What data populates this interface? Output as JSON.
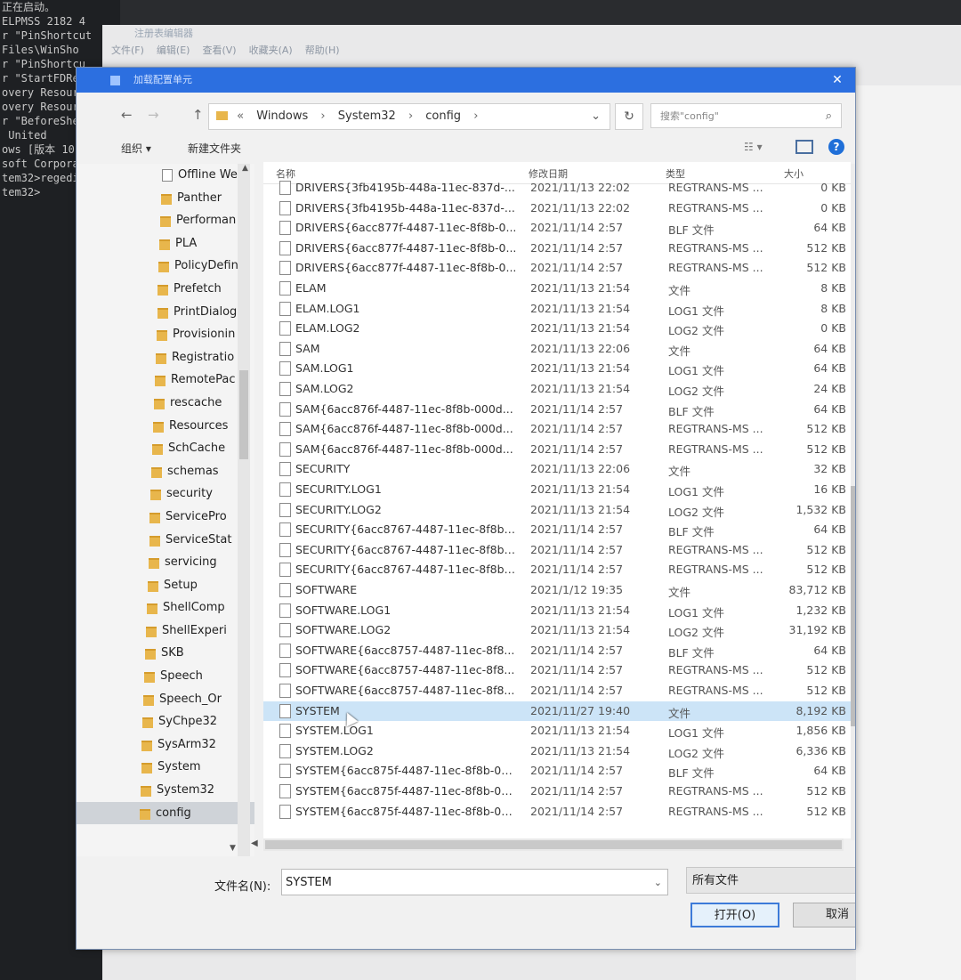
{
  "console": {
    "lines": [
      "正在启动。",
      "ELPMSS 2182 4",
      "r \"PinShortcut",
      "Files\\WinSho",
      "",
      "r \"PinShortcu",
      "r \"StartFDRes",
      "overy Resourc",
      "overy Resourc",
      "",
      "r \"BeforeShel",
      " United",
      "ows [版本 10",
      "soft Corpora",
      "",
      "tem32>regedi",
      "",
      "tem32>"
    ]
  },
  "bg_window": {
    "title": "注册表编辑器",
    "menu": [
      "文件(F)",
      "编辑(E)",
      "查看(V)",
      "收藏夹(A)",
      "帮助(H)"
    ]
  },
  "dialog": {
    "title": "加载配置单元",
    "close": "✕"
  },
  "nav": {
    "back": "←",
    "forward": "→",
    "up": "↑",
    "breadcrumbs": [
      "«",
      "Windows",
      "System32",
      "config"
    ],
    "refresh": "↻",
    "search_placeholder": "搜索\"config\""
  },
  "toolbar": {
    "organize": "组织 ▾",
    "new_folder": "新建文件夹",
    "view": "☷ ▾",
    "help": "?"
  },
  "tree": [
    {
      "label": "Offline We",
      "type": "doc"
    },
    {
      "label": "Panther",
      "type": "folder"
    },
    {
      "label": "Performan",
      "type": "folder"
    },
    {
      "label": "PLA",
      "type": "folder"
    },
    {
      "label": "PolicyDefin",
      "type": "folder"
    },
    {
      "label": "Prefetch",
      "type": "folder"
    },
    {
      "label": "PrintDialog",
      "type": "folder"
    },
    {
      "label": "Provisionin",
      "type": "folder"
    },
    {
      "label": "Registratio",
      "type": "folder"
    },
    {
      "label": "RemotePac",
      "type": "folder"
    },
    {
      "label": "rescache",
      "type": "folder"
    },
    {
      "label": "Resources",
      "type": "folder"
    },
    {
      "label": "SchCache",
      "type": "folder"
    },
    {
      "label": "schemas",
      "type": "folder"
    },
    {
      "label": "security",
      "type": "folder"
    },
    {
      "label": "ServicePro",
      "type": "folder"
    },
    {
      "label": "ServiceStat",
      "type": "folder"
    },
    {
      "label": "servicing",
      "type": "folder"
    },
    {
      "label": "Setup",
      "type": "folder"
    },
    {
      "label": "ShellComp",
      "type": "folder"
    },
    {
      "label": "ShellExperi",
      "type": "folder"
    },
    {
      "label": "SKB",
      "type": "folder"
    },
    {
      "label": "Speech",
      "type": "folder"
    },
    {
      "label": "Speech_Or",
      "type": "folder"
    },
    {
      "label": "SyChpe32",
      "type": "folder"
    },
    {
      "label": "SysArm32",
      "type": "folder"
    },
    {
      "label": "System",
      "type": "folder"
    },
    {
      "label": "System32",
      "type": "folder"
    },
    {
      "label": "config",
      "type": "folder",
      "selected": true
    }
  ],
  "columns": {
    "name": "名称",
    "date": "修改日期",
    "type": "类型",
    "size": "大小"
  },
  "files": [
    {
      "name": "DRIVERS{3fb4195b-448a-11ec-837d-...",
      "date": "2021/11/13 22:02",
      "type": "REGTRANS-MS ...",
      "size": "0 KB"
    },
    {
      "name": "DRIVERS{3fb4195b-448a-11ec-837d-...",
      "date": "2021/11/13 22:02",
      "type": "REGTRANS-MS ...",
      "size": "0 KB"
    },
    {
      "name": "DRIVERS{6acc877f-4487-11ec-8f8b-0...",
      "date": "2021/11/14 2:57",
      "type": "BLF 文件",
      "size": "64 KB"
    },
    {
      "name": "DRIVERS{6acc877f-4487-11ec-8f8b-0...",
      "date": "2021/11/14 2:57",
      "type": "REGTRANS-MS ...",
      "size": "512 KB"
    },
    {
      "name": "DRIVERS{6acc877f-4487-11ec-8f8b-0...",
      "date": "2021/11/14 2:57",
      "type": "REGTRANS-MS ...",
      "size": "512 KB"
    },
    {
      "name": "ELAM",
      "date": "2021/11/13 21:54",
      "type": "文件",
      "size": "8 KB"
    },
    {
      "name": "ELAM.LOG1",
      "date": "2021/11/13 21:54",
      "type": "LOG1 文件",
      "size": "8 KB"
    },
    {
      "name": "ELAM.LOG2",
      "date": "2021/11/13 21:54",
      "type": "LOG2 文件",
      "size": "0 KB"
    },
    {
      "name": "SAM",
      "date": "2021/11/13 22:06",
      "type": "文件",
      "size": "64 KB"
    },
    {
      "name": "SAM.LOG1",
      "date": "2021/11/13 21:54",
      "type": "LOG1 文件",
      "size": "64 KB"
    },
    {
      "name": "SAM.LOG2",
      "date": "2021/11/13 21:54",
      "type": "LOG2 文件",
      "size": "24 KB"
    },
    {
      "name": "SAM{6acc876f-4487-11ec-8f8b-000d...",
      "date": "2021/11/14 2:57",
      "type": "BLF 文件",
      "size": "64 KB"
    },
    {
      "name": "SAM{6acc876f-4487-11ec-8f8b-000d...",
      "date": "2021/11/14 2:57",
      "type": "REGTRANS-MS ...",
      "size": "512 KB"
    },
    {
      "name": "SAM{6acc876f-4487-11ec-8f8b-000d...",
      "date": "2021/11/14 2:57",
      "type": "REGTRANS-MS ...",
      "size": "512 KB"
    },
    {
      "name": "SECURITY",
      "date": "2021/11/13 22:06",
      "type": "文件",
      "size": "32 KB"
    },
    {
      "name": "SECURITY.LOG1",
      "date": "2021/11/13 21:54",
      "type": "LOG1 文件",
      "size": "16 KB"
    },
    {
      "name": "SECURITY.LOG2",
      "date": "2021/11/13 21:54",
      "type": "LOG2 文件",
      "size": "1,532 KB"
    },
    {
      "name": "SECURITY{6acc8767-4487-11ec-8f8b-...",
      "date": "2021/11/14 2:57",
      "type": "BLF 文件",
      "size": "64 KB"
    },
    {
      "name": "SECURITY{6acc8767-4487-11ec-8f8b-...",
      "date": "2021/11/14 2:57",
      "type": "REGTRANS-MS ...",
      "size": "512 KB"
    },
    {
      "name": "SECURITY{6acc8767-4487-11ec-8f8b-...",
      "date": "2021/11/14 2:57",
      "type": "REGTRANS-MS ...",
      "size": "512 KB"
    },
    {
      "name": "SOFTWARE",
      "date": "2021/1/12 19:35",
      "type": "文件",
      "size": "83,712 KB"
    },
    {
      "name": "SOFTWARE.LOG1",
      "date": "2021/11/13 21:54",
      "type": "LOG1 文件",
      "size": "1,232 KB"
    },
    {
      "name": "SOFTWARE.LOG2",
      "date": "2021/11/13 21:54",
      "type": "LOG2 文件",
      "size": "31,192 KB"
    },
    {
      "name": "SOFTWARE{6acc8757-4487-11ec-8f8...",
      "date": "2021/11/14 2:57",
      "type": "BLF 文件",
      "size": "64 KB"
    },
    {
      "name": "SOFTWARE{6acc8757-4487-11ec-8f8...",
      "date": "2021/11/14 2:57",
      "type": "REGTRANS-MS ...",
      "size": "512 KB"
    },
    {
      "name": "SOFTWARE{6acc8757-4487-11ec-8f8...",
      "date": "2021/11/14 2:57",
      "type": "REGTRANS-MS ...",
      "size": "512 KB"
    },
    {
      "name": "SYSTEM",
      "date": "2021/11/27 19:40",
      "type": "文件",
      "size": "8,192 KB",
      "selected": true
    },
    {
      "name": "SYSTEM.LOG1",
      "date": "2021/11/13 21:54",
      "type": "LOG1 文件",
      "size": "1,856 KB"
    },
    {
      "name": "SYSTEM.LOG2",
      "date": "2021/11/13 21:54",
      "type": "LOG2 文件",
      "size": "6,336 KB"
    },
    {
      "name": "SYSTEM{6acc875f-4487-11ec-8f8b-00...",
      "date": "2021/11/14 2:57",
      "type": "BLF 文件",
      "size": "64 KB"
    },
    {
      "name": "SYSTEM{6acc875f-4487-11ec-8f8b-00...",
      "date": "2021/11/14 2:57",
      "type": "REGTRANS-MS ...",
      "size": "512 KB"
    },
    {
      "name": "SYSTEM{6acc875f-4487-11ec-8f8b-00...",
      "date": "2021/11/14 2:57",
      "type": "REGTRANS-MS ...",
      "size": "512 KB"
    }
  ],
  "footer": {
    "filename_label": "文件名(N):",
    "filename_value": "SYSTEM",
    "filter": "所有文件",
    "open": "打开(O)",
    "cancel": "取消"
  },
  "colors": {
    "titlebar": "#2c6fe0",
    "selection": "#cce4f7",
    "folder": "#e8b64c"
  }
}
